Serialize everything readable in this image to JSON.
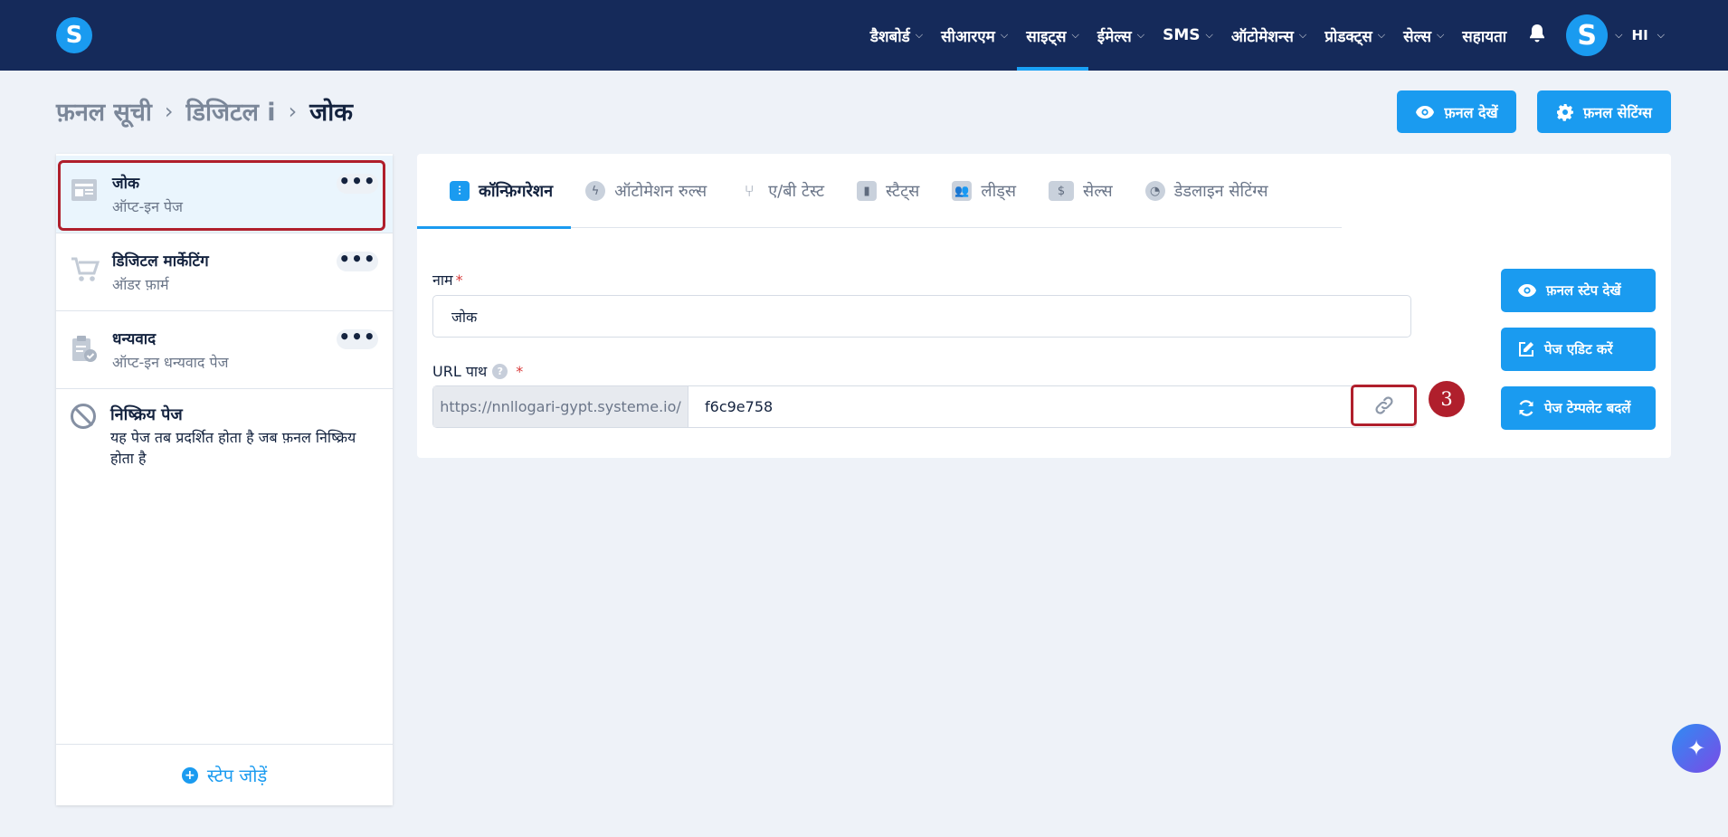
{
  "nav": {
    "items": [
      {
        "label": "डैशबोर्ड",
        "active": false
      },
      {
        "label": "सीआरएम",
        "active": false
      },
      {
        "label": "साइट्स",
        "active": true
      },
      {
        "label": "ईमेल्स",
        "active": false
      },
      {
        "label": "SMS",
        "active": false
      },
      {
        "label": "ऑटोमेशन्स",
        "active": false
      },
      {
        "label": "प्रोडक्ट्स",
        "active": false
      },
      {
        "label": "सेल्स",
        "active": false
      }
    ],
    "help_label": "सहायता",
    "logo_letter": "S",
    "avatar_letter": "S",
    "language": "HI"
  },
  "breadcrumb": {
    "items": [
      "फ़नल सूची",
      "डिजिटल i",
      "जोक"
    ]
  },
  "header_buttons": {
    "view_funnel": "फ़नल देखें",
    "funnel_settings": "फ़नल सेटिंग्स"
  },
  "sidebar": {
    "steps": [
      {
        "title": "जोक",
        "subtitle": "ऑप्ट-इन पेज",
        "icon": "optin-page-icon"
      },
      {
        "title": "डिजिटल मार्केटिंग",
        "subtitle": "ऑडर फ़ार्म",
        "icon": "cart-icon"
      },
      {
        "title": "धन्यवाद",
        "subtitle": "ऑप्ट-इन धन्यवाद पेज",
        "icon": "clipboard-check-icon"
      }
    ],
    "inactive_title": "निष्क्रिय पेज",
    "inactive_desc": "यह पेज तब प्रदर्शित होता है जब फ़नल निष्क्रिय होता है",
    "add_step": "स्टेप जोड़ें"
  },
  "tabs": [
    {
      "label": "कॉन्फ़िगरेशन",
      "active": true
    },
    {
      "label": "ऑटोमेशन रुल्स",
      "active": false
    },
    {
      "label": "ए/बी टेस्ट",
      "active": false
    },
    {
      "label": "स्टैट्स",
      "active": false
    },
    {
      "label": "लीड्स",
      "active": false
    },
    {
      "label": "सेल्स",
      "active": false
    },
    {
      "label": "डेडलाइन सेटिंग्स",
      "active": false
    }
  ],
  "form": {
    "name_label": "नाम",
    "name_value": "जोक",
    "url_label": "URL पाथ",
    "url_prefix": "https://nnllogari-gypt.systeme.io/",
    "url_value": "f6c9e758",
    "required_mark": "*",
    "help_mark": "?"
  },
  "side_buttons": {
    "view_step": "फ़नल स्टेप देखें",
    "edit_page": "पेज एडिट करें",
    "change_template": "पेज टेम्पलेट बदलें"
  },
  "annotation_badge": "3",
  "colors": {
    "topbar": "#152a5a",
    "accent": "#1a9bf0",
    "highlight": "#b01f2c",
    "background": "#eef2f8"
  }
}
